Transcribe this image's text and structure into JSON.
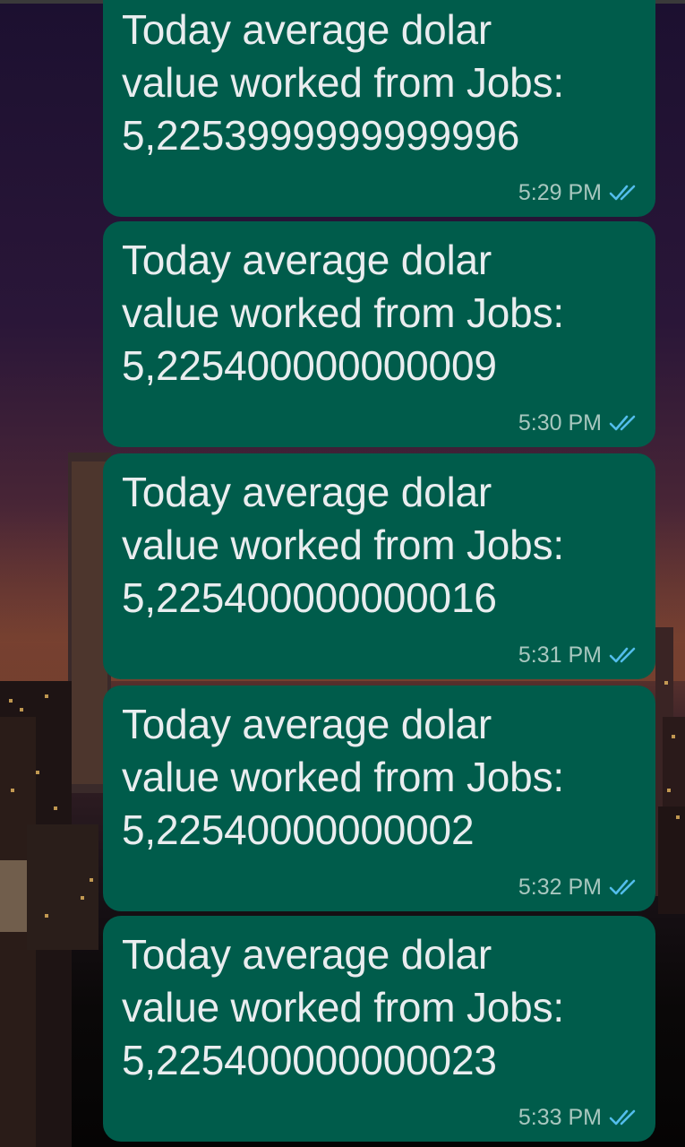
{
  "colors": {
    "bubble": "#005c4b",
    "text": "#e9edef",
    "timestamp": "#a8c7bf",
    "read_ticks": "#53bdeb"
  },
  "messages": [
    {
      "text": "Today average dolar\nvalue worked from Jobs:\n5,2253999999999996",
      "time": "5:29 PM",
      "status_icon": "double-check-read-icon"
    },
    {
      "text": "Today average dolar\nvalue worked from Jobs:\n5,225400000000009",
      "time": "5:30 PM",
      "status_icon": "double-check-read-icon"
    },
    {
      "text": "Today average dolar\nvalue worked from Jobs:\n5,225400000000016",
      "time": "5:31 PM",
      "status_icon": "double-check-read-icon"
    },
    {
      "text": "Today average dolar\nvalue worked from Jobs:\n5,22540000000002",
      "time": "5:32 PM",
      "status_icon": "double-check-read-icon"
    },
    {
      "text": "Today average dolar\nvalue worked from Jobs:\n5,225400000000023",
      "time": "5:33 PM",
      "status_icon": "double-check-read-icon"
    }
  ]
}
